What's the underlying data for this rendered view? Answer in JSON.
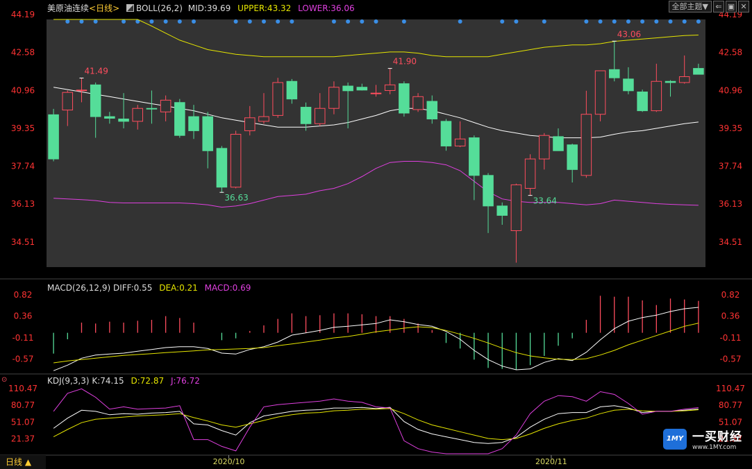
{
  "header": {
    "symbol": "美原油连续",
    "period": "<日线>",
    "boll_label": "BOLL(26,2)",
    "mid": "MID:39.69",
    "upper": "UPPER:43.32",
    "lower": "LOWER:36.06"
  },
  "toolbar": {
    "theme_label": "全部主题▼",
    "icons": [
      "back-icon",
      "expand-icon",
      "close-icon"
    ]
  },
  "macd_header": {
    "label": "MACD(26,12,9)",
    "diff": "DIFF:0.55",
    "dea": "DEA:0.21",
    "macd": "MACD:0.69"
  },
  "kdj_header": {
    "label": "KDJ(9,3,3)",
    "k": "K:74.15",
    "d": "D:72.87",
    "j": "J:76.72"
  },
  "period_tab": "日线 ▲",
  "brand": {
    "name": "一买财经",
    "url": "www.1MY.com",
    "logo_text": "1MY"
  },
  "colors": {
    "up": "#ff4d5e",
    "down": "#55dd99",
    "mid": "#ffffff",
    "upper": "#e6e600",
    "lower": "#e040e0",
    "axis": "#ff3333",
    "price_bg": "#333333"
  },
  "chart_data": [
    {
      "type": "candlestick",
      "title": "美原油连续",
      "y_ticks": [
        "44.19",
        "42.58",
        "40.96",
        "39.35",
        "37.74",
        "36.13",
        "34.51"
      ],
      "ylim": [
        33.45,
        44.19
      ],
      "x_labels": [
        "2020/10",
        "2020/11"
      ],
      "annotations": [
        {
          "index": 2,
          "text": "41.49",
          "at": "high"
        },
        {
          "index": 12,
          "text": "36.63",
          "at": "low"
        },
        {
          "index": 24,
          "text": "41.90",
          "at": "high"
        },
        {
          "index": 34,
          "text": "33.64",
          "at": "low"
        },
        {
          "index": 40,
          "text": "43.06",
          "at": "high"
        }
      ],
      "ohlc": [
        [
          39.93,
          40.18,
          37.95,
          38.05
        ],
        [
          40.13,
          40.96,
          39.45,
          40.88
        ],
        [
          40.96,
          41.49,
          40.46,
          40.98
        ],
        [
          41.2,
          41.3,
          38.95,
          39.85
        ],
        [
          39.85,
          40.05,
          39.55,
          39.78
        ],
        [
          39.75,
          40.85,
          39.35,
          39.65
        ],
        [
          39.65,
          40.35,
          39.3,
          40.2
        ],
        [
          40.2,
          40.96,
          39.55,
          40.18
        ],
        [
          40.05,
          40.75,
          39.65,
          40.55
        ],
        [
          40.45,
          40.6,
          38.95,
          39.05
        ],
        [
          39.85,
          40.35,
          38.9,
          39.25
        ],
        [
          39.85,
          40.05,
          37.65,
          38.4
        ],
        [
          38.5,
          38.6,
          36.63,
          36.85
        ],
        [
          36.85,
          39.25,
          36.8,
          39.1
        ],
        [
          39.25,
          40.3,
          39.05,
          39.8
        ],
        [
          39.65,
          40.85,
          39.55,
          39.85
        ],
        [
          39.9,
          41.5,
          39.8,
          41.3
        ],
        [
          41.35,
          41.45,
          40.4,
          40.6
        ],
        [
          40.25,
          40.45,
          39.25,
          39.55
        ],
        [
          39.55,
          40.85,
          39.45,
          40.2
        ],
        [
          40.2,
          41.35,
          39.95,
          41.1
        ],
        [
          41.15,
          41.3,
          39.35,
          40.95
        ],
        [
          41.1,
          41.25,
          40.96,
          40.98
        ],
        [
          40.85,
          41.2,
          40.7,
          40.85
        ],
        [
          40.96,
          41.9,
          40.8,
          41.2
        ],
        [
          41.25,
          41.35,
          39.85,
          40.0
        ],
        [
          40.15,
          40.85,
          40.05,
          40.7
        ],
        [
          40.5,
          40.75,
          39.55,
          39.75
        ],
        [
          39.65,
          39.75,
          38.4,
          38.6
        ],
        [
          38.6,
          39.65,
          38.55,
          38.9
        ],
        [
          38.95,
          39.05,
          36.3,
          37.35
        ],
        [
          37.35,
          37.45,
          34.9,
          36.05
        ],
        [
          36.05,
          36.2,
          35.25,
          35.65
        ],
        [
          35.0,
          37.0,
          33.64,
          36.95
        ],
        [
          36.8,
          38.25,
          36.5,
          38.05
        ],
        [
          38.05,
          39.15,
          37.6,
          39.05
        ],
        [
          39.0,
          39.35,
          38.55,
          38.4
        ],
        [
          38.65,
          38.7,
          37.05,
          37.6
        ],
        [
          37.35,
          40.95,
          37.25,
          39.95
        ],
        [
          39.95,
          41.8,
          39.65,
          41.8
        ],
        [
          41.85,
          43.06,
          41.35,
          41.5
        ],
        [
          41.45,
          41.95,
          40.8,
          40.95
        ],
        [
          40.9,
          41.0,
          40.05,
          40.1
        ],
        [
          40.1,
          42.1,
          40.05,
          41.35
        ],
        [
          41.35,
          41.4,
          40.7,
          41.3
        ],
        [
          41.3,
          42.45,
          41.25,
          41.55
        ],
        [
          41.9,
          42.1,
          41.7,
          41.65
        ]
      ],
      "bands": {
        "upper": [
          45.8,
          45.5,
          45.2,
          44.9,
          44.6,
          44.3,
          44.0,
          43.7,
          43.4,
          43.1,
          42.9,
          42.7,
          42.6,
          42.5,
          42.45,
          42.4,
          42.4,
          42.4,
          42.4,
          42.4,
          42.4,
          42.45,
          42.5,
          42.55,
          42.6,
          42.6,
          42.55,
          42.45,
          42.4,
          42.4,
          42.4,
          42.4,
          42.5,
          42.6,
          42.7,
          42.8,
          42.85,
          42.9,
          42.9,
          42.95,
          43.05,
          43.1,
          43.15,
          43.2,
          43.25,
          43.3,
          43.32
        ],
        "mid": [
          41.1,
          41.0,
          40.9,
          40.8,
          40.7,
          40.6,
          40.5,
          40.4,
          40.3,
          40.2,
          40.1,
          39.95,
          39.8,
          39.7,
          39.6,
          39.5,
          39.4,
          39.4,
          39.4,
          39.45,
          39.5,
          39.6,
          39.75,
          39.9,
          40.1,
          40.2,
          40.2,
          40.1,
          39.95,
          39.8,
          39.6,
          39.4,
          39.25,
          39.15,
          39.05,
          39.0,
          38.95,
          38.95,
          38.95,
          38.98,
          39.1,
          39.2,
          39.25,
          39.35,
          39.45,
          39.55,
          39.62
        ],
        "lower": [
          36.38,
          36.35,
          36.32,
          36.28,
          36.2,
          36.18,
          36.18,
          36.18,
          36.18,
          36.18,
          36.15,
          36.1,
          36.0,
          36.05,
          36.15,
          36.3,
          36.45,
          36.5,
          36.55,
          36.7,
          36.8,
          37.0,
          37.3,
          37.65,
          37.9,
          37.95,
          37.95,
          37.9,
          37.8,
          37.55,
          37.1,
          36.65,
          36.35,
          36.25,
          36.2,
          36.2,
          36.2,
          36.15,
          36.1,
          36.15,
          36.3,
          36.25,
          36.2,
          36.15,
          36.12,
          36.1,
          36.08
        ]
      }
    },
    {
      "type": "macd",
      "title": "MACD(26,12,9)",
      "y_ticks": [
        "0.82",
        "0.36",
        "-0.11",
        "-0.57"
      ],
      "ylim": [
        -0.86,
        0.82
      ],
      "hist": [
        -0.45,
        -0.14,
        0.22,
        0.2,
        0.24,
        0.22,
        0.26,
        0.28,
        0.36,
        0.32,
        0.22,
        0.0,
        -0.16,
        -0.12,
        0.04,
        0.16,
        0.3,
        0.42,
        0.36,
        0.38,
        0.42,
        0.42,
        0.4,
        0.36,
        0.36,
        0.3,
        0.2,
        0.06,
        -0.22,
        -0.34,
        -0.58,
        -0.76,
        -0.78,
        -0.8,
        -0.7,
        -0.5,
        -0.28,
        -0.12,
        0.28,
        0.8,
        0.78,
        0.78,
        0.7,
        0.6,
        0.74,
        0.72,
        0.69
      ],
      "diff": [
        -0.82,
        -0.7,
        -0.55,
        -0.48,
        -0.46,
        -0.44,
        -0.4,
        -0.36,
        -0.32,
        -0.3,
        -0.3,
        -0.34,
        -0.44,
        -0.46,
        -0.36,
        -0.3,
        -0.2,
        -0.05,
        0.0,
        0.05,
        0.12,
        0.14,
        0.17,
        0.2,
        0.28,
        0.24,
        0.18,
        0.14,
        0.03,
        -0.14,
        -0.38,
        -0.58,
        -0.72,
        -0.8,
        -0.78,
        -0.64,
        -0.56,
        -0.6,
        -0.42,
        -0.15,
        0.09,
        0.25,
        0.33,
        0.38,
        0.46,
        0.52,
        0.55
      ],
      "dea": [
        -0.65,
        -0.61,
        -0.58,
        -0.55,
        -0.52,
        -0.49,
        -0.47,
        -0.45,
        -0.43,
        -0.41,
        -0.39,
        -0.37,
        -0.36,
        -0.35,
        -0.34,
        -0.32,
        -0.28,
        -0.24,
        -0.2,
        -0.16,
        -0.11,
        -0.08,
        -0.03,
        0.02,
        0.06,
        0.1,
        0.13,
        0.11,
        0.05,
        -0.03,
        -0.12,
        -0.22,
        -0.33,
        -0.43,
        -0.5,
        -0.54,
        -0.57,
        -0.58,
        -0.56,
        -0.48,
        -0.38,
        -0.26,
        -0.16,
        -0.06,
        0.04,
        0.14,
        0.21
      ]
    },
    {
      "type": "kdj",
      "title": "KDJ(9,3,3)",
      "y_ticks": [
        "110.47",
        "80.77",
        "51.07",
        "21.37"
      ],
      "ylim": [
        -5,
        110.47
      ],
      "k": [
        40,
        58,
        72,
        70,
        64,
        66,
        65,
        67,
        68,
        70,
        48,
        46,
        36,
        28,
        50,
        62,
        66,
        70,
        72,
        73,
        76,
        76,
        77,
        75,
        77,
        52,
        38,
        30,
        25,
        20,
        15,
        13,
        15,
        24,
        42,
        56,
        66,
        68,
        68,
        78,
        80,
        76,
        68,
        70,
        70,
        72,
        74.15
      ],
      "d": [
        25,
        38,
        50,
        56,
        58,
        60,
        62,
        63,
        64,
        66,
        59,
        53,
        46,
        42,
        48,
        54,
        60,
        64,
        67,
        68,
        71,
        72,
        74,
        74,
        75,
        66,
        55,
        46,
        40,
        34,
        28,
        22,
        20,
        22,
        30,
        40,
        48,
        54,
        58,
        66,
        72,
        74,
        71,
        70,
        70,
        71,
        72.87
      ],
      "j": [
        70,
        102,
        110,
        95,
        74,
        78,
        74,
        75,
        76,
        80,
        20,
        20,
        8,
        0,
        42,
        78,
        82,
        84,
        86,
        88,
        92,
        88,
        86,
        78,
        76,
        18,
        4,
        -2,
        -5,
        -5,
        -5,
        -5,
        4,
        28,
        66,
        88,
        98,
        96,
        88,
        105,
        100,
        84,
        65,
        70,
        70,
        74,
        76.72
      ]
    }
  ]
}
